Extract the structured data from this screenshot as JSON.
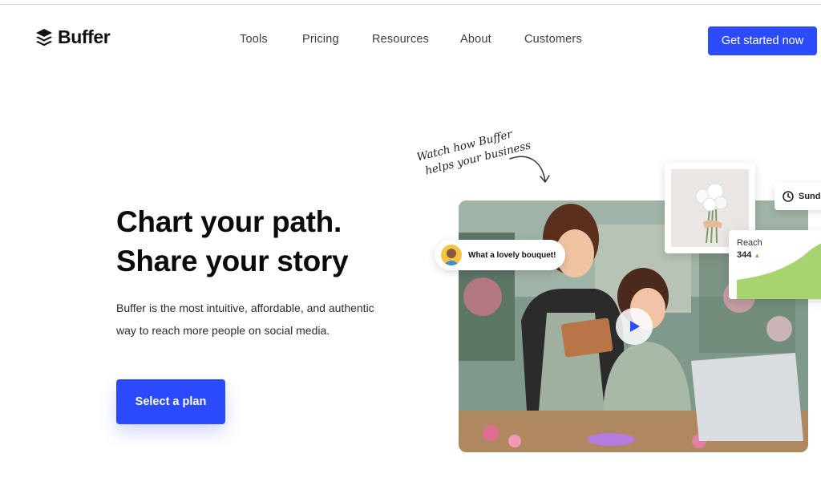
{
  "header": {
    "logo_text": "Buffer",
    "nav": [
      "Tools",
      "Pricing",
      "Resources",
      "About",
      "Customers"
    ],
    "cta_label": "Get started now"
  },
  "hero": {
    "title_line1": "Chart your path.",
    "title_line2": "Share your story",
    "description": "Buffer is the most intuitive, affordable, and authentic way to reach more people on social media.",
    "button_label": "Select a plan"
  },
  "visual": {
    "note_line1": "Watch how Buffer",
    "note_line2": "helps your business",
    "comment_text": "What a lovely bouquet!",
    "schedule_label": "Sunda",
    "reach_label": "Reach",
    "reach_value": "344",
    "play_icon": "play-icon"
  },
  "colors": {
    "accent": "#2c4bff",
    "chart_green": "#a8d46f"
  }
}
